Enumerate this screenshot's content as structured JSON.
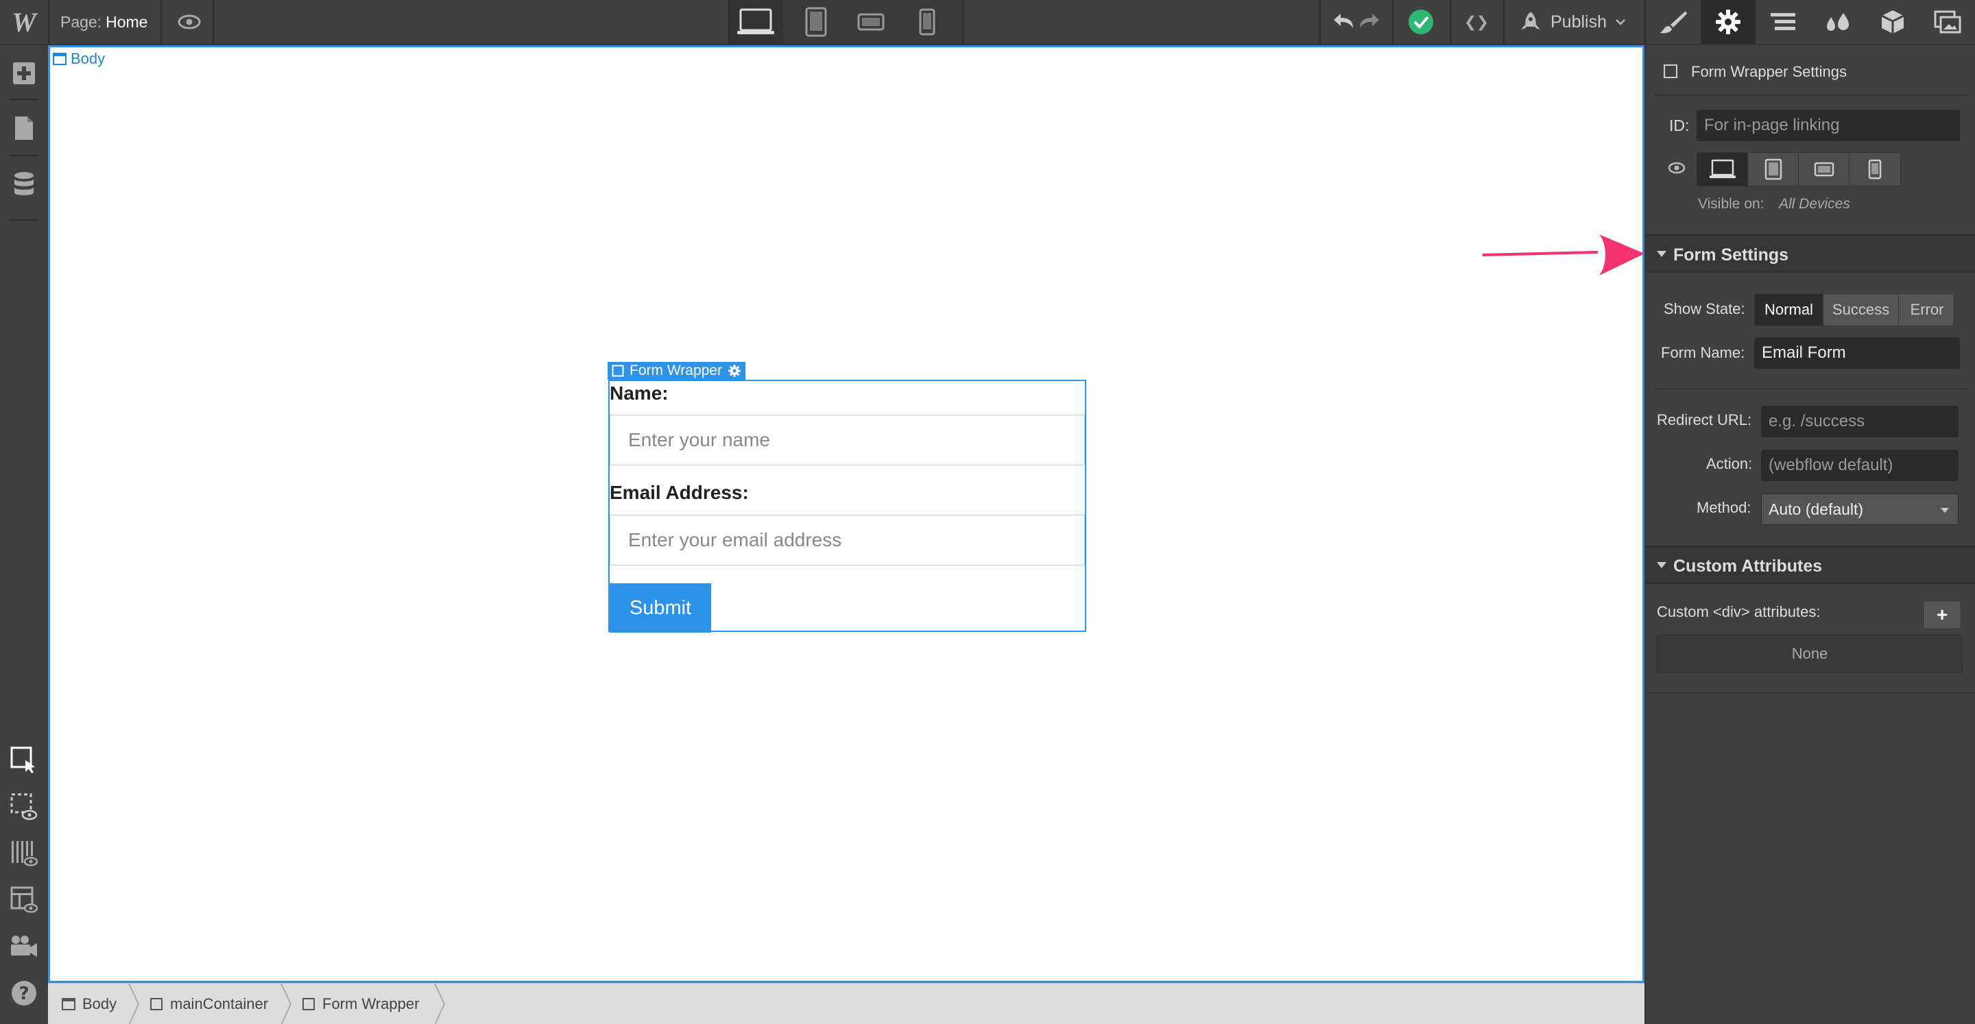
{
  "topbar": {
    "logo": "W",
    "page_prefix": "Page:",
    "page_name": "Home",
    "publish_label": "Publish",
    "code_label": "❮❯"
  },
  "canvas": {
    "body_tag": "Body",
    "form_tag": "Form Wrapper",
    "form": {
      "name_label": "Name:",
      "name_placeholder": "Enter your name",
      "email_label": "Email Address:",
      "email_placeholder": "Enter your email address",
      "submit_label": "Submit"
    }
  },
  "breadcrumb": [
    {
      "label": "Body"
    },
    {
      "label": "mainContainer"
    },
    {
      "label": "Form Wrapper"
    }
  ],
  "panel": {
    "header_title": "Form Wrapper Settings",
    "id_label": "ID:",
    "id_placeholder": "For in-page linking",
    "visible_on_label": "Visible on:",
    "visible_on_value": "All Devices",
    "form_settings_title": "Form Settings",
    "show_state_label": "Show State:",
    "states": [
      "Normal",
      "Success",
      "Error"
    ],
    "active_state": "Normal",
    "form_name_label": "Form Name:",
    "form_name_value": "Email Form",
    "redirect_label": "Redirect URL:",
    "redirect_placeholder": "e.g. /success",
    "action_label": "Action:",
    "action_placeholder": "(webflow default)",
    "method_label": "Method:",
    "method_value": "Auto (default)",
    "custom_attr_title": "Custom Attributes",
    "custom_div_label": "Custom <div> attributes:",
    "add_label": "+",
    "none_label": "None"
  },
  "colors": {
    "accent": "#2c93e8",
    "success": "#2fb673",
    "annotation_arrow": "#f2336f"
  }
}
